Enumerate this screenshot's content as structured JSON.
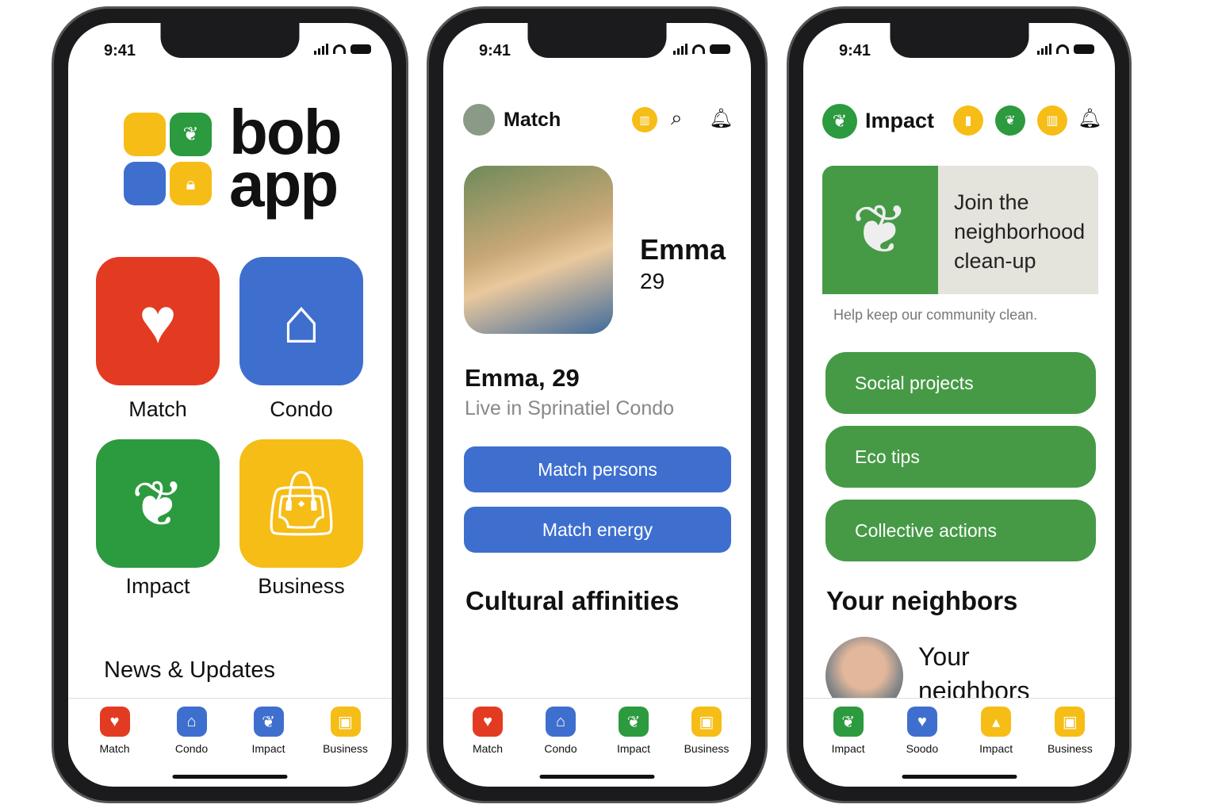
{
  "status": {
    "time": "9:41"
  },
  "colors": {
    "red": "#e33b22",
    "blue": "#3e6fcf",
    "green": "#2c9a3e",
    "yellow": "#f6bd17",
    "impact_green": "#469a46"
  },
  "home": {
    "logo_line1": "bob",
    "logo_line2": "app",
    "tiles": [
      {
        "label": "Match",
        "icon": "heart-icon"
      },
      {
        "label": "Condo",
        "icon": "house-icon"
      },
      {
        "label": "Impact",
        "icon": "leaf-icon"
      },
      {
        "label": "Business",
        "icon": "shopping-bag-icon"
      }
    ],
    "news_title": "News & Updates",
    "tabs": [
      {
        "label": "Match"
      },
      {
        "label": "Condo"
      },
      {
        "label": "Impact"
      },
      {
        "label": "Business"
      }
    ]
  },
  "match": {
    "title": "Match",
    "name": "Emma",
    "age": "29",
    "name_age": "Emma, 29",
    "location": "Live in Sprinatiel Condo",
    "btn_persons": "Match persons",
    "btn_energy": "Match energy",
    "section": "Cultural affinities",
    "tabs": [
      {
        "label": "Match"
      },
      {
        "label": "Condo"
      },
      {
        "label": "Impact"
      },
      {
        "label": "Business"
      }
    ]
  },
  "impact": {
    "title": "Impact",
    "banner": "Join the neighborhood clean-up",
    "banner_sub": "Help keep our community clean.",
    "buttons": [
      "Social projects",
      "Eco tips",
      "Collective actions"
    ],
    "neighbors_title": "Your neighbors",
    "neighbors_card": "Your neighbors",
    "tabs": [
      {
        "label": "Impact"
      },
      {
        "label": "Soodo"
      },
      {
        "label": "Impact"
      },
      {
        "label": "Business"
      }
    ]
  }
}
